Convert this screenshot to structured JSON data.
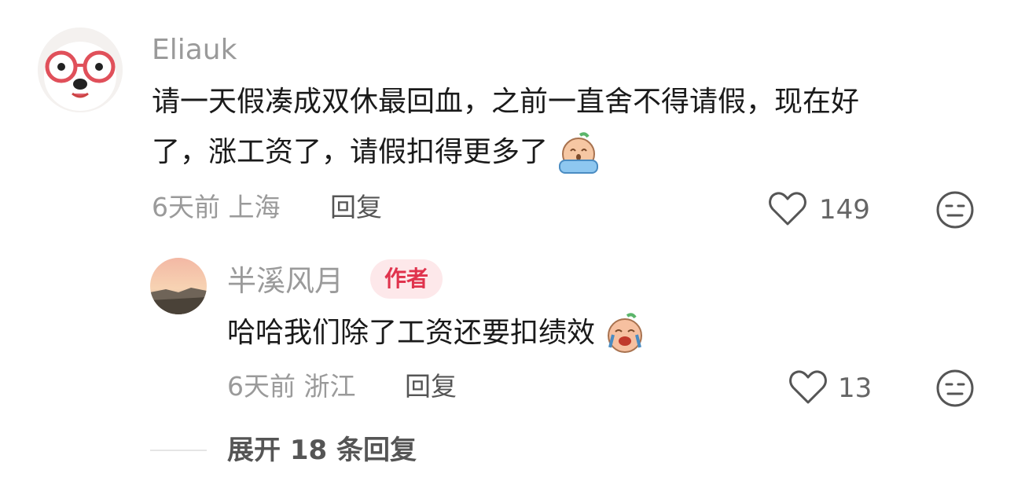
{
  "comment": {
    "username": "Eliauk",
    "text_line1": "请一天假凑成双休最回血，之前一直舍不得请假，现在好",
    "text_line2": "了，涨工资了，请假扣得更多了",
    "time": "6天前",
    "location": "上海",
    "reply_label": "回复",
    "likes": "149"
  },
  "reply": {
    "username": "半溪风月",
    "badge": "作者",
    "text": "哈哈我们除了工资还要扣绩效",
    "time": "6天前",
    "location": "浙江",
    "reply_label": "回复",
    "likes": "13"
  },
  "expand_label": "展开 18 条回复",
  "icons": {
    "like": "heart-outline-icon",
    "dislike": "meh-face-icon",
    "emoji1": "crying-face-emoji",
    "emoji2": "laughing-crying-emoji"
  },
  "colors": {
    "badge_bg": "#fde8ea",
    "badge_text": "#e0334d"
  }
}
